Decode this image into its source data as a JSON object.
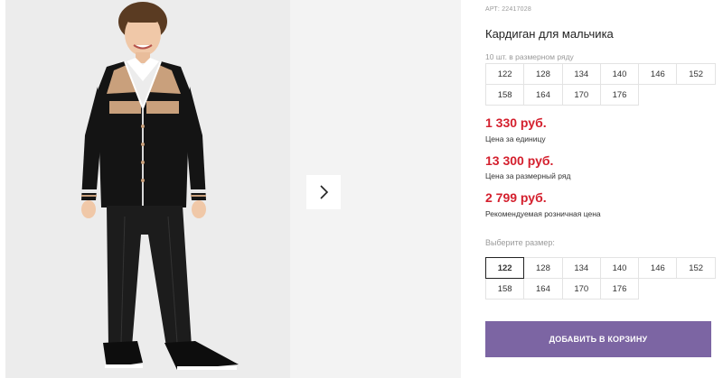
{
  "product": {
    "article": "АРТ: 22417028",
    "title": "Кардиган для мальчика"
  },
  "size_row": {
    "note": "10 шт. в размерном ряду",
    "sizes": [
      "122",
      "128",
      "134",
      "140",
      "146",
      "152",
      "158",
      "164",
      "170",
      "176"
    ]
  },
  "prices": [
    {
      "value": "1 330 руб.",
      "note": "Цена за единицу"
    },
    {
      "value": "13 300 руб.",
      "note": "Цена за размерный ряд"
    },
    {
      "value": "2 799 руб.",
      "note": "Рекомендуемая розничная цена"
    }
  ],
  "size_select": {
    "label": "Выберите размер:",
    "sizes": [
      "122",
      "128",
      "134",
      "140",
      "146",
      "152",
      "158",
      "164",
      "170",
      "176"
    ],
    "selected": "122"
  },
  "cart": {
    "add_label": "ДОБАВИТЬ В КОРЗИНУ"
  },
  "colors": {
    "price_red": "#d4202e",
    "button_purple": "#7c65a3"
  },
  "icons": {
    "next": "chevron-right-icon"
  }
}
